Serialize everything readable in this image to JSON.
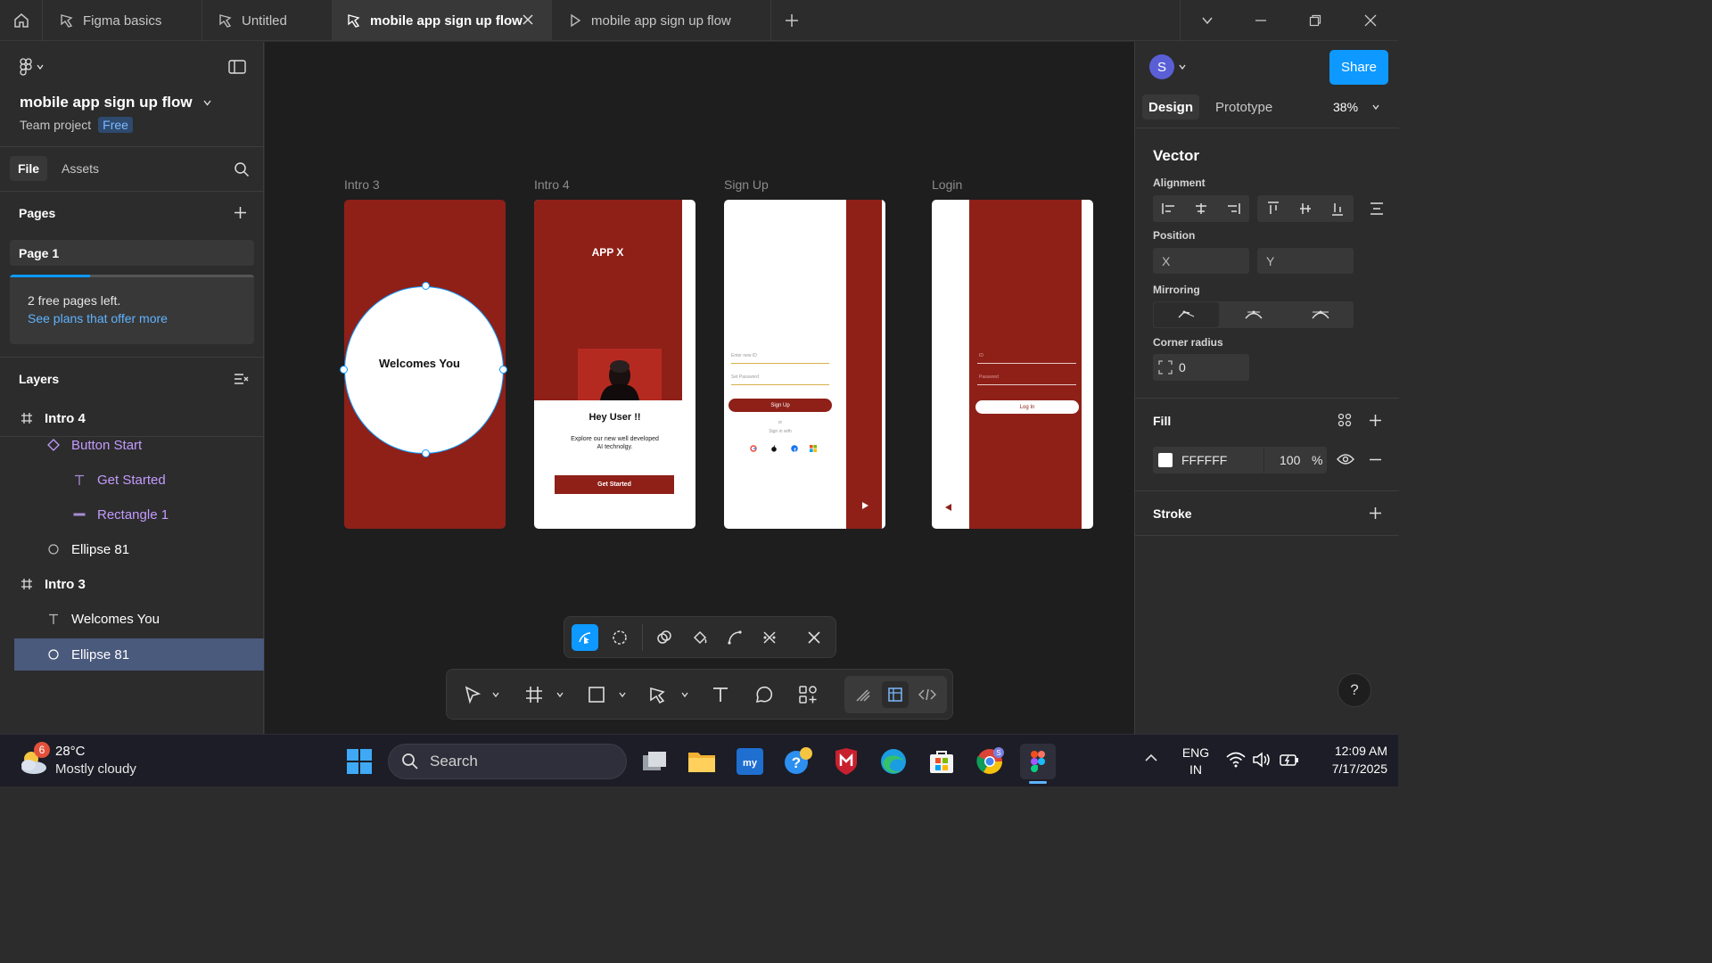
{
  "tabs": [
    {
      "label": "Figma basics"
    },
    {
      "label": "Untitled"
    },
    {
      "label": "mobile app sign up flow"
    },
    {
      "label": "mobile app sign up flow"
    }
  ],
  "file": {
    "name": "mobile app sign up flow",
    "team": "Team project",
    "plan_badge": "Free"
  },
  "left_tabs": {
    "file": "File",
    "assets": "Assets"
  },
  "pages": {
    "header": "Pages",
    "items": [
      "Page 1"
    ],
    "notice_text": "2 free pages left.",
    "notice_link": "See plans that offer more"
  },
  "layers": {
    "header": "Layers",
    "items": [
      {
        "label": "Intro 4",
        "type": "frame"
      },
      {
        "label": "Button Start",
        "type": "component"
      },
      {
        "label": "Get Started",
        "type": "text"
      },
      {
        "label": "Rectangle 1",
        "type": "rectangle"
      },
      {
        "label": "Ellipse 81",
        "type": "ellipse"
      },
      {
        "label": "Intro 3",
        "type": "frame"
      },
      {
        "label": "Welcomes You",
        "type": "text"
      },
      {
        "label": "Ellipse 81",
        "type": "ellipse",
        "selected": true
      }
    ]
  },
  "canvas": {
    "frames": [
      {
        "label": "Intro 3",
        "circle_text": "Welcomes You"
      },
      {
        "label": "Intro 4",
        "app_title": "APP X",
        "greeting": "Hey User !!",
        "desc_line1": "Explore our new well developed",
        "desc_line2": "AI technolgy.",
        "button": "Get Started"
      },
      {
        "label": "Sign Up",
        "field1": "Enter new ID",
        "field2": "Set Password",
        "button": "Sign Up",
        "or_text": "or",
        "sign_in_with": "Sign in with"
      },
      {
        "label": "Login",
        "field1": "ID",
        "field2": "Password",
        "button": "Log In"
      }
    ],
    "colors": {
      "brand_red": "#8e2018",
      "canvas_bg": "#1e1e1e",
      "selection_blue": "#0d99ff"
    }
  },
  "toolbar": {
    "vector_tools": [
      "bend-tool-icon",
      "lasso-icon",
      "shape-builder-icon",
      "paint-bucket-icon",
      "curve-icon",
      "cut-icon",
      "close-icon"
    ],
    "main_tools": [
      "move-icon",
      "frame-icon",
      "rectangle-icon",
      "pen-icon",
      "text-icon",
      "comment-icon",
      "actions-icon",
      "draw-mode-icon",
      "design-mode-icon",
      "dev-mode-icon"
    ]
  },
  "right": {
    "avatar_initial": "S",
    "share": "Share",
    "tab_design": "Design",
    "tab_prototype": "Prototype",
    "zoom": "38%",
    "selection_title": "Vector",
    "alignment_label": "Alignment",
    "position_label": "Position",
    "x_label": "X",
    "y_label": "Y",
    "mirroring_label": "Mirroring",
    "corner_radius_label": "Corner radius",
    "corner_radius_value": "0",
    "fill_label": "Fill",
    "fill_hex": "FFFFFF",
    "fill_opacity": "100",
    "percent": "%",
    "stroke_label": "Stroke",
    "help": "?"
  },
  "taskbar": {
    "weather_badge": "6",
    "temperature": "28°C",
    "condition": "Mostly cloudy",
    "search_placeholder": "Search",
    "lang1": "ENG",
    "lang2": "IN",
    "time": "12:09 AM",
    "date": "7/17/2025"
  }
}
